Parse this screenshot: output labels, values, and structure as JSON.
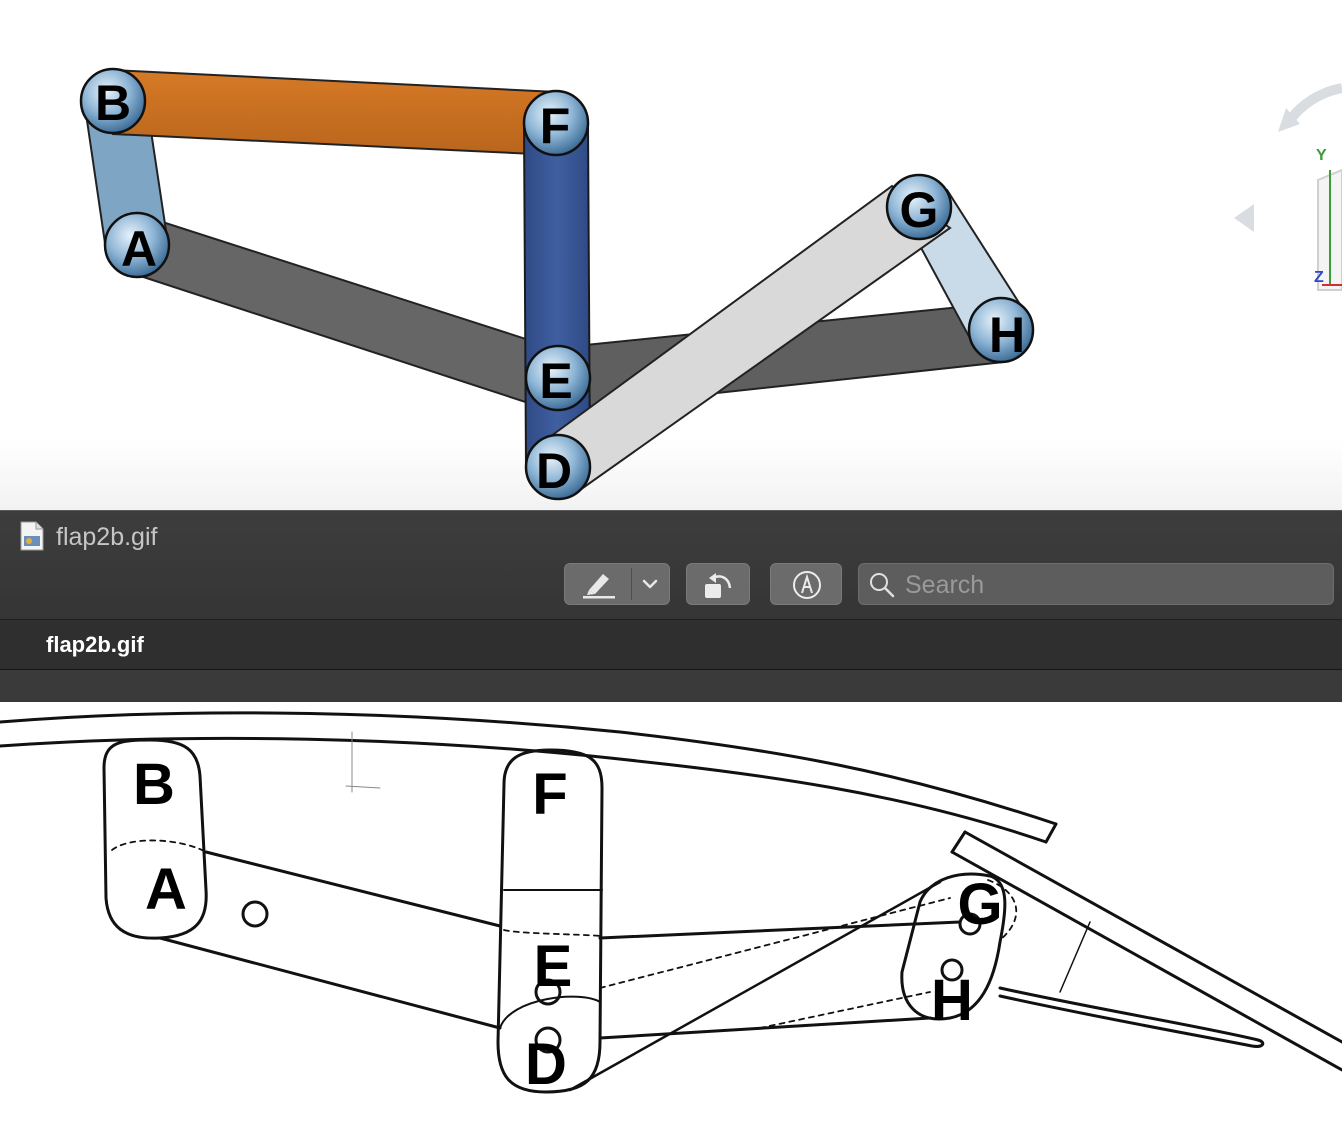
{
  "cad_view": {
    "joints": [
      "A",
      "B",
      "D",
      "E",
      "F",
      "G",
      "H"
    ],
    "axes": {
      "y": "Y",
      "z": "Z"
    },
    "colors": {
      "link_orange": "#c86e22",
      "link_blue": "#3b5797",
      "link_dark_gray": "#666666",
      "link_light_gray": "#d9d9d9",
      "link_steel_blue": "#7ea6c4",
      "link_pale_blue": "#c9dbe8"
    }
  },
  "window": {
    "title": "flap2b.gif",
    "file_icon": "gif-document-icon"
  },
  "toolbar": {
    "markup_icon": "highlighter-icon",
    "markup_menu_icon": "chevron-down-icon",
    "rotate_icon": "rotate-left-icon",
    "annotate_icon": "pen-circle-icon",
    "search_placeholder": "Search"
  },
  "tabs": [
    {
      "label": "flap2b.gif"
    }
  ],
  "sketch": {
    "labels": [
      "B",
      "A",
      "F",
      "E",
      "D",
      "G",
      "H"
    ]
  }
}
